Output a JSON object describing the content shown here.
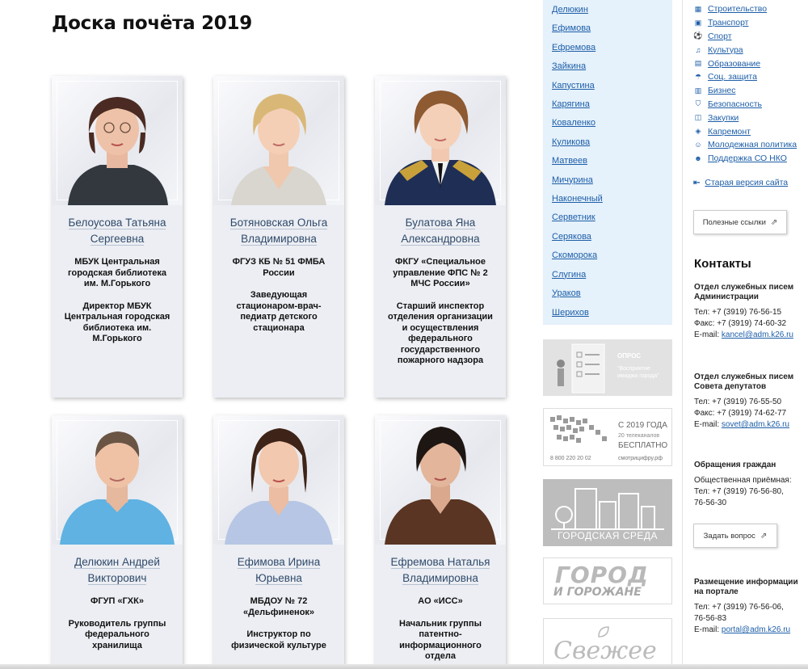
{
  "page_title": "Доска почёта 2019",
  "people": [
    {
      "name": "Белоусова Татьяна Сергеевна",
      "org": "МБУК Центральная городская библиотека им. М.Горького",
      "position": "Директор МБУК Центральная городская библиотека им. М.Горького"
    },
    {
      "name": "Ботяновская Ольга Владимировна",
      "org": "ФГУЗ КБ № 51 ФМБА России",
      "position": "Заведующая стационаром-врач-педиатр детского стационара"
    },
    {
      "name": "Булатова Яна Александровна",
      "org": "ФКГУ «Специальное управление ФПС № 2 МЧС России»",
      "position": "Старший инспектор отделения организации и осуществления федерального государственного пожарного надзора"
    },
    {
      "name": "Делюкин Андрей Викторович",
      "org": "ФГУП «ГХК»",
      "position": "Руководитель группы федерального хранилища"
    },
    {
      "name": "Ефимова Ирина Юрьевна",
      "org": "МБДОУ № 72 «Дельфиненок»",
      "position": "Инструктор по физической культуре"
    },
    {
      "name": "Ефремова Наталья Владимировна",
      "org": "АО «ИСС»",
      "position": "Начальник группы патентно-информационного отдела"
    }
  ],
  "surnames": [
    "Делюкин",
    "Ефимова",
    "Ефремова",
    "Зайкина",
    "Капустина",
    "Карягина",
    "Коваленко",
    "Куликова",
    "Матвеев",
    "Мичурина",
    "Наконечный",
    "Серветник",
    "Серякова",
    "Скоморока",
    "Слугина",
    "Ураков",
    "Шерихов"
  ],
  "banners": {
    "opros_label": "ОПРОС",
    "opros_sub": "\"Восприятие имиджа города\"",
    "digital_year": "С 2019 ГОДА",
    "digital_channels": "20 телеканалов",
    "digital_free": "БЕСПЛАТНО",
    "digital_phone": "8 800 220 20 02",
    "digital_site": "смотрицифру.рф",
    "city_env": "ГОРОДСКАЯ СРЕДА",
    "gorod_line1": "ГОРОД",
    "gorod_line2": "И ГОРОЖАНЕ",
    "svezhee": "Свежее"
  },
  "rubrics": [
    {
      "icon": "building-icon",
      "glyph": "▦",
      "label": "Строительство"
    },
    {
      "icon": "bus-icon",
      "glyph": "▣",
      "label": "Транспорт"
    },
    {
      "icon": "ball-icon",
      "glyph": "⚽",
      "label": "Спорт"
    },
    {
      "icon": "music-icon",
      "glyph": "♫",
      "label": "Культура"
    },
    {
      "icon": "book-icon",
      "glyph": "▤",
      "label": "Образование"
    },
    {
      "icon": "umbrella-icon",
      "glyph": "☂",
      "label": "Соц. защита"
    },
    {
      "icon": "briefcase-icon",
      "glyph": "▥",
      "label": "Бизнес"
    },
    {
      "icon": "shield-icon",
      "glyph": "⛉",
      "label": "Безопасность"
    },
    {
      "icon": "cart-icon",
      "glyph": "◫",
      "label": "Закупки"
    },
    {
      "icon": "cube-icon",
      "glyph": "◈",
      "label": "Капремонт"
    },
    {
      "icon": "people-icon",
      "glyph": "☺",
      "label": "Молодежная политика"
    },
    {
      "icon": "users-icon",
      "glyph": "☻",
      "label": "Поддержка СО НКО"
    }
  ],
  "old_site": "Старая версия сайта",
  "useful_links": "Полезные ссылки",
  "contacts": {
    "title": "Контакты",
    "admin": {
      "heading": "Отдел служебных писем Администрации",
      "tel": "Тел: +7 (3919) 76-56-15",
      "fax": "Факс: +7 (3919) 74-60-32",
      "email_label": "E-mail:",
      "email": "kancel@adm.k26.ru"
    },
    "deputies": {
      "heading": "Отдел служебных писем Совета депутатов",
      "tel": "Тел: +7 (3919) 76-55-50",
      "fax": "Факс: +7 (3919) 74-62-77",
      "email_label": "E-mail:",
      "email": "sovet@adm.k26.ru"
    },
    "citizens": {
      "heading": "Обращения граждан",
      "line1": "Общественная приёмная:",
      "line2": "Тел: +7 (3919) 76-56-80,",
      "line3": "76-56-30"
    },
    "ask_button": "Задать вопрос",
    "portal": {
      "heading": "Размещение информации на портале",
      "tel1": "Тел: +7 (3919) 76-56-06,",
      "tel2": "76-56-83",
      "email_label": "E-mail:",
      "email": "portal@adm.k26.ru"
    }
  }
}
